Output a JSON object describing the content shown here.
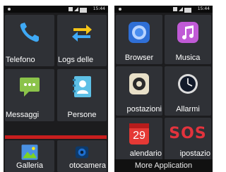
{
  "left_screen": {
    "time": "15:44",
    "tiles": [
      {
        "label": "Telefono",
        "icon": "phone-icon"
      },
      {
        "label": "Logs delle",
        "icon": "call-logs-icon"
      },
      {
        "label": "Messaggi",
        "icon": "messages-icon"
      },
      {
        "label": "Persone",
        "icon": "contacts-icon"
      },
      {
        "label": "Galleria",
        "icon": "gallery-icon"
      },
      {
        "label": "otocamera",
        "icon": "camera-icon"
      }
    ]
  },
  "right_screen": {
    "time": "15:44",
    "tiles": [
      {
        "label": "Browser",
        "icon": "browser-icon"
      },
      {
        "label": "Musica",
        "icon": "music-icon"
      },
      {
        "label": "postazioni",
        "icon": "settings-icon"
      },
      {
        "label": "Allarmi",
        "icon": "alarm-clock-icon"
      },
      {
        "label": "alendario",
        "icon": "calendar-icon",
        "day": "29"
      },
      {
        "label": "ipostazio",
        "icon": "sos-icon",
        "text": "SOS"
      }
    ],
    "more_button": "More Application"
  },
  "colors": {
    "tile_bg": "#2f3136",
    "screen_bg": "#1c1c1e",
    "accent_red": "#e2333d",
    "phone_green": "#4fc3f7"
  }
}
